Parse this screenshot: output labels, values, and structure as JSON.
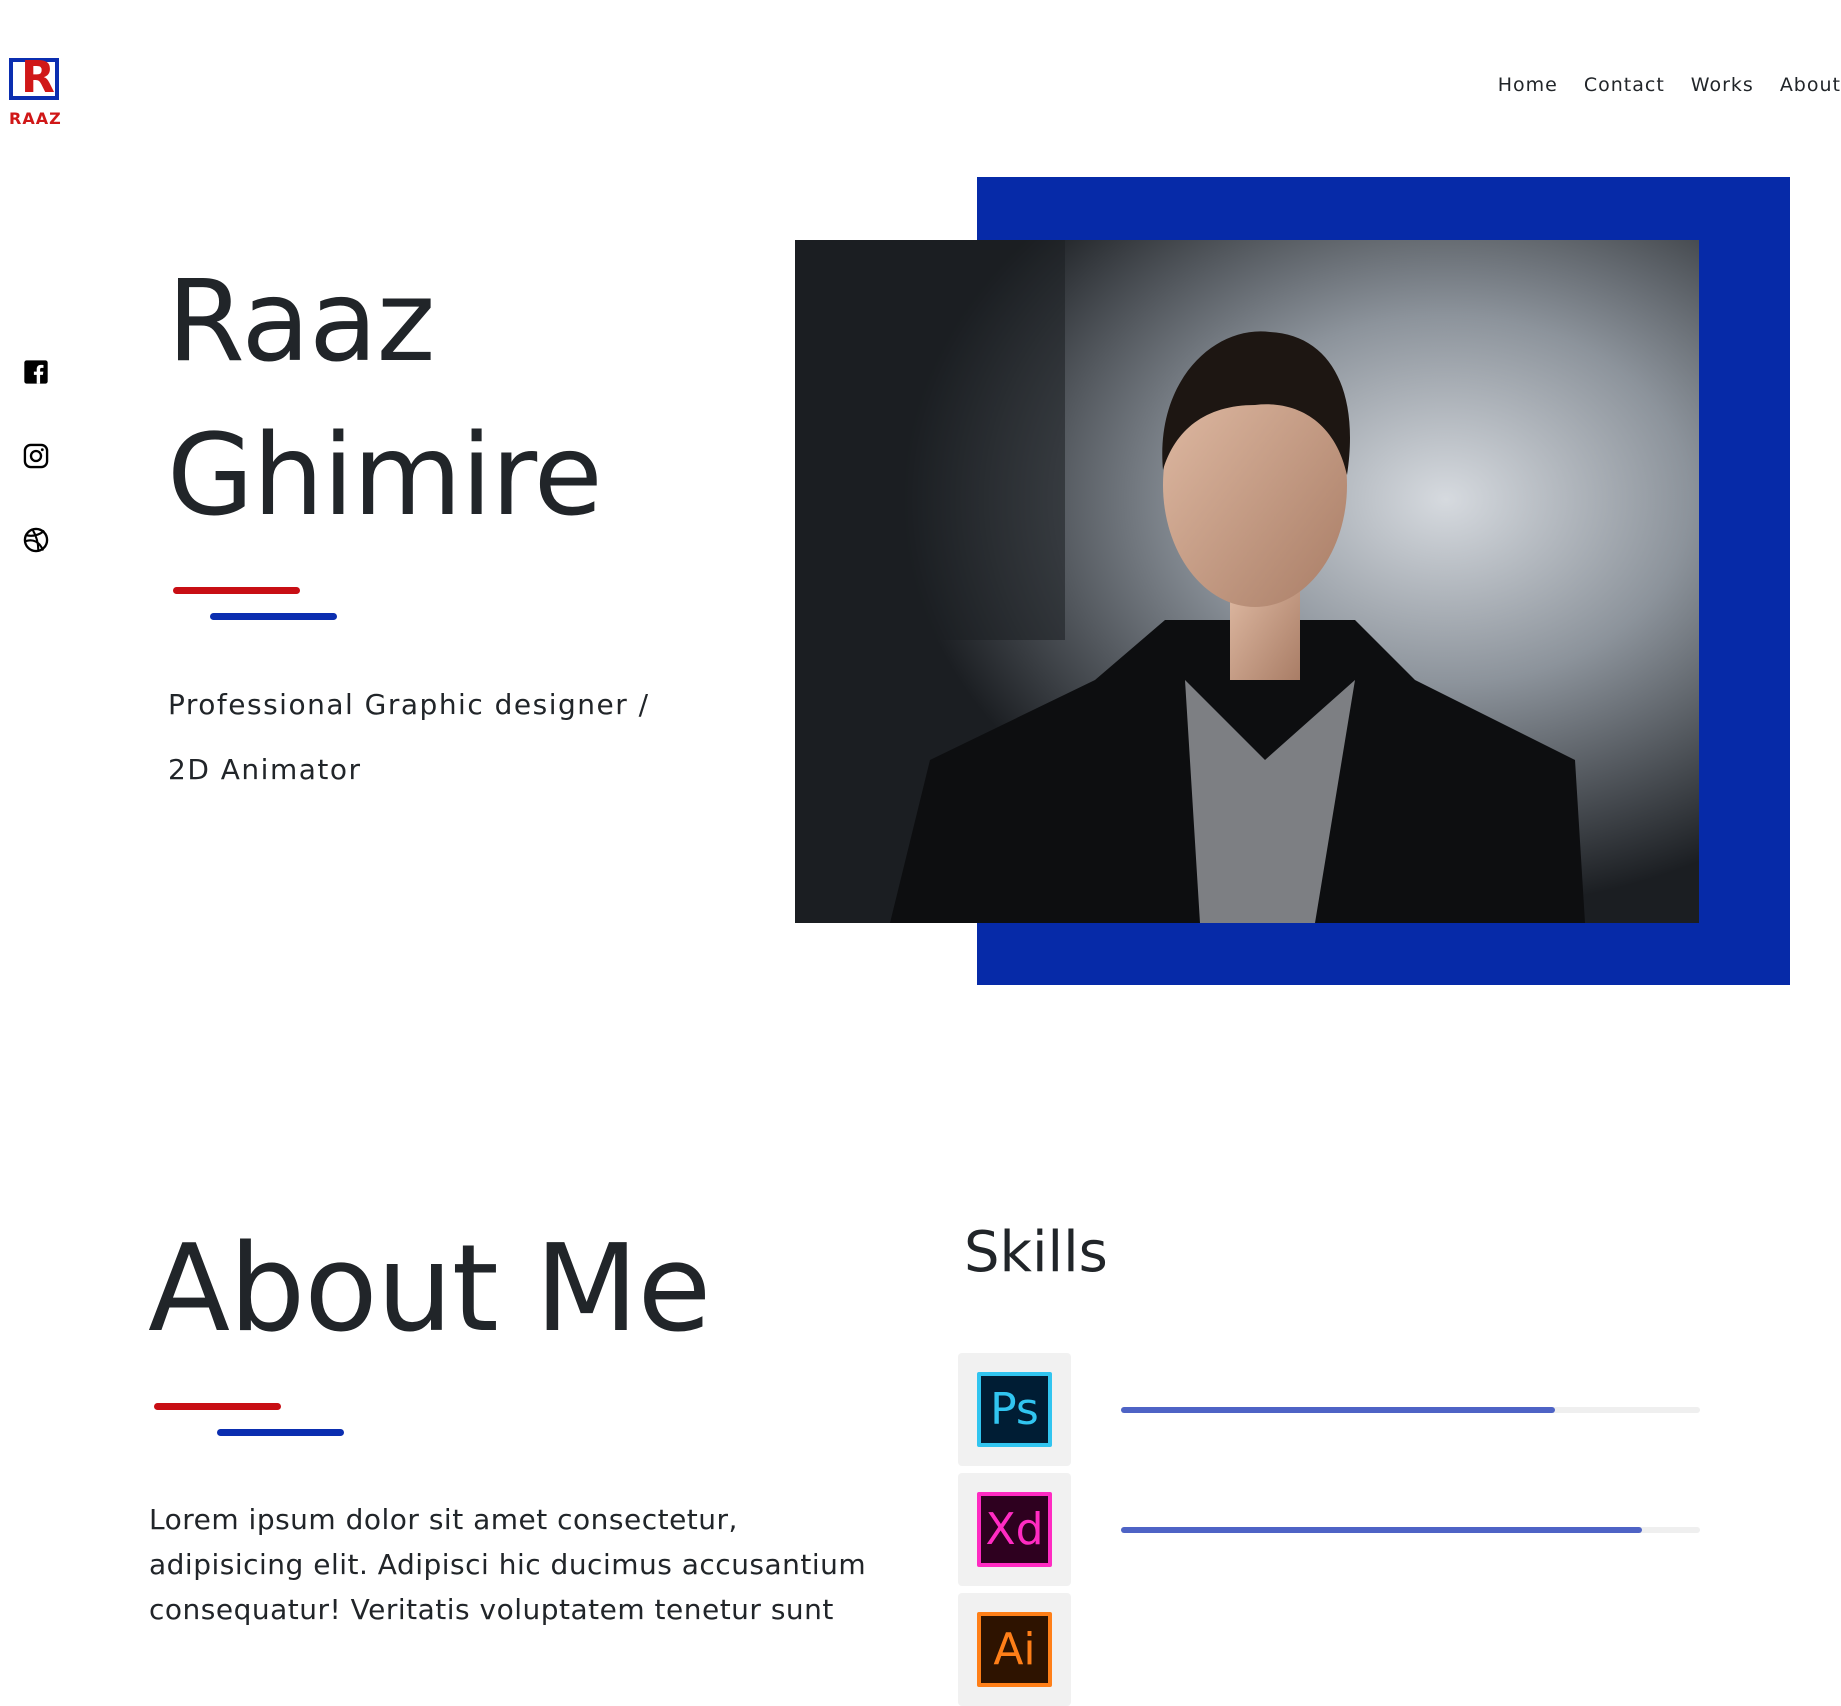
{
  "brand": {
    "logo_letter": "R",
    "logo_text": "RAAZ"
  },
  "nav": {
    "items": [
      "Home",
      "Contact",
      "Works",
      "About"
    ]
  },
  "social": [
    "facebook-icon",
    "instagram-icon",
    "dribbble-icon"
  ],
  "hero": {
    "first_name": "Raaz",
    "last_name": "Ghimire",
    "tagline_line1": "Professional Graphic designer /",
    "tagline_line2": "2D Animator",
    "photo_frame_color": "#062aa8"
  },
  "about": {
    "title": "About Me",
    "text": "Lorem ipsum dolor sit amet consectetur, adipisicing elit. Adipisci hic ducimus accusantium consequatur! Veritatis voluptatem tenetur sunt"
  },
  "skills": {
    "title": "Skills",
    "items": [
      {
        "abbr": "Ps",
        "level": 0.75,
        "bg": "#001d34",
        "color": "#31c5f0"
      },
      {
        "abbr": "Xd",
        "level": 0.9,
        "bg": "#2e001f",
        "color": "#ff2bc2"
      },
      {
        "abbr": "Ai",
        "level": null,
        "bg": "#2e1300",
        "color": "#ff7f18"
      }
    ]
  },
  "colors": {
    "accent_red": "#c80e14",
    "accent_blue": "#0b2eb0",
    "bar_fill": "#4e63c5",
    "text": "#212529"
  }
}
